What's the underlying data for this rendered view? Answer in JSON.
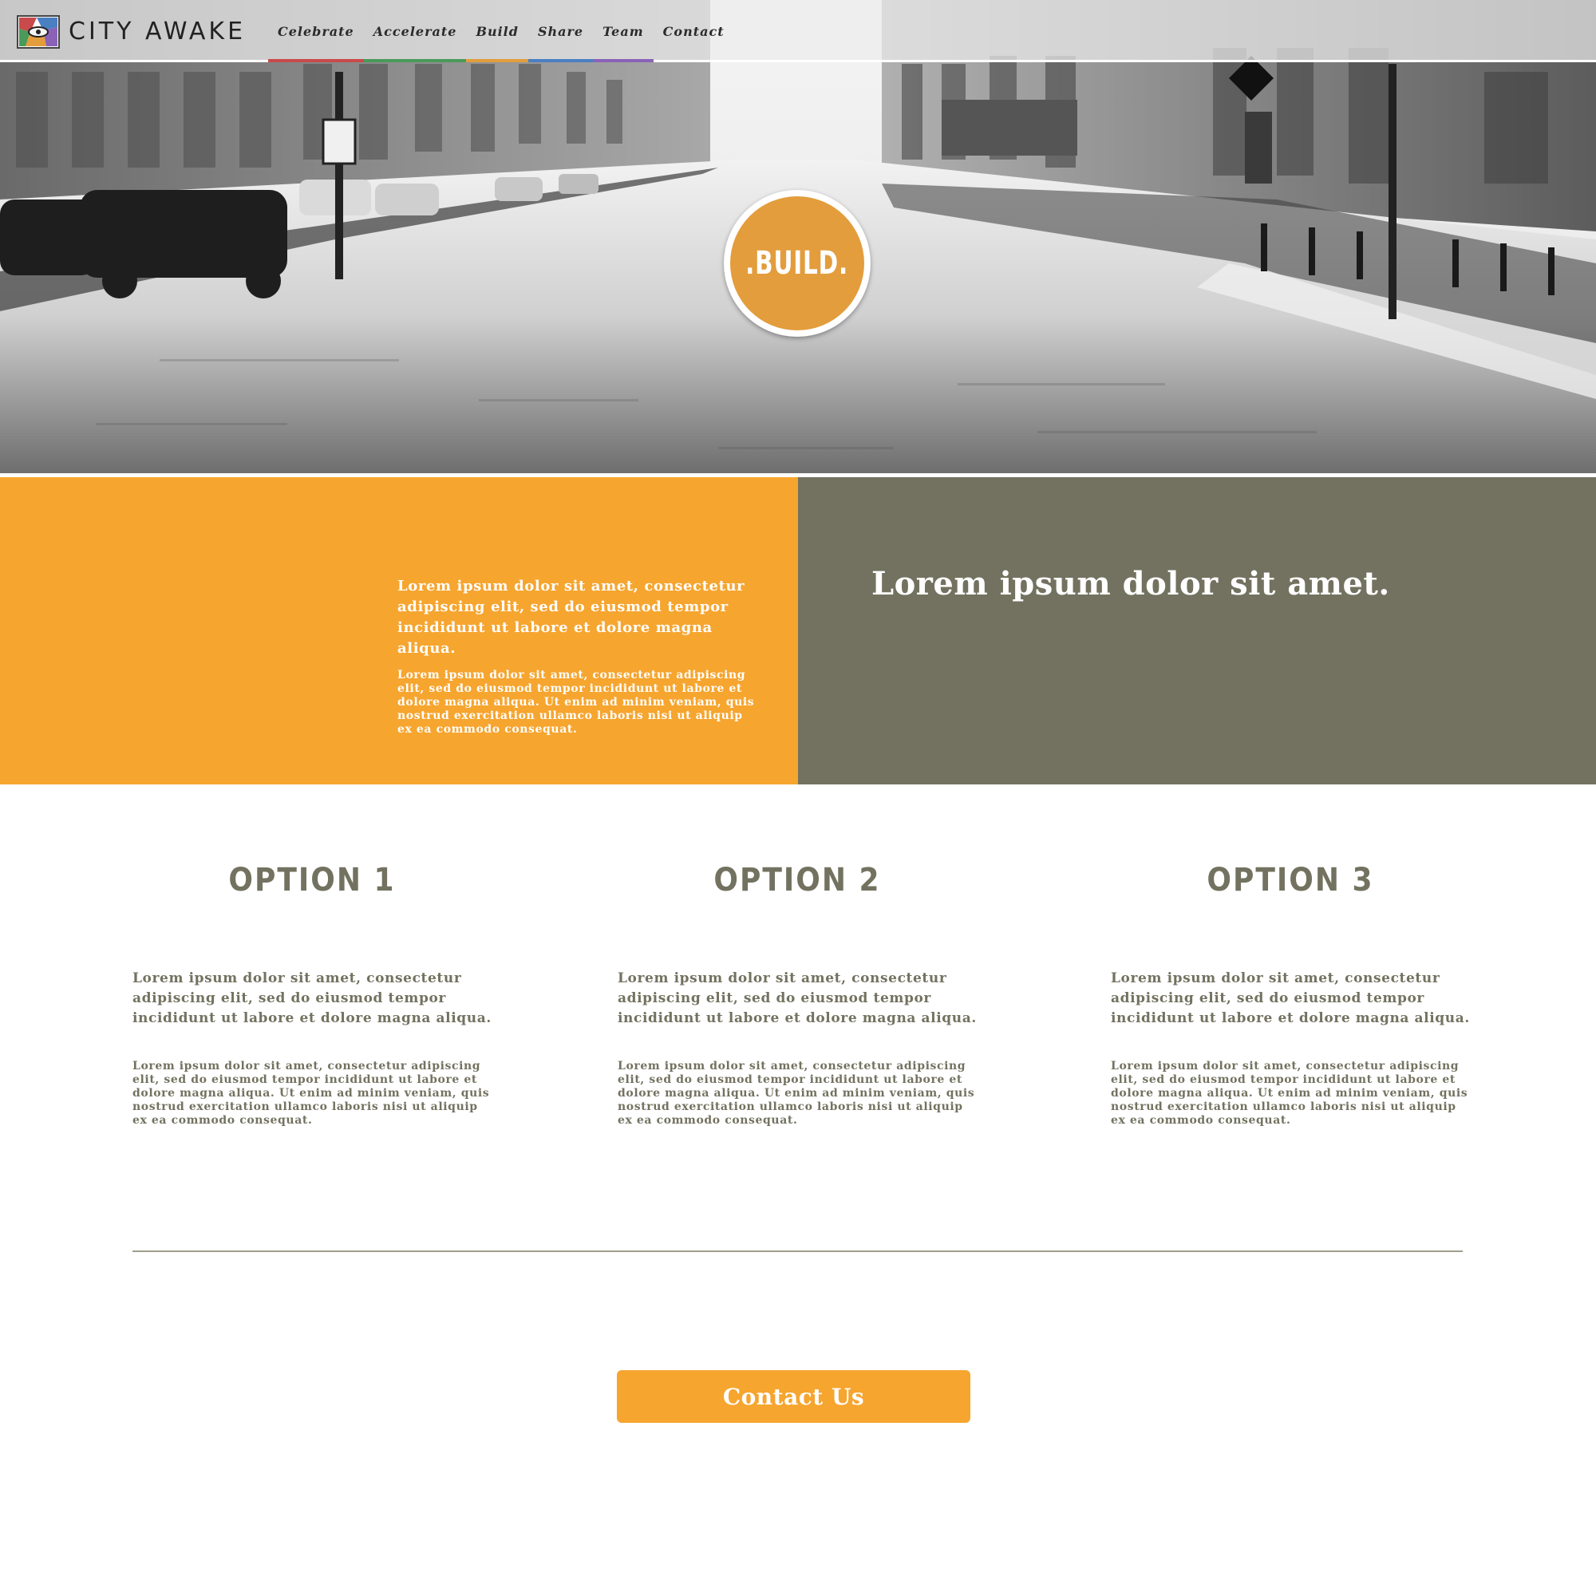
{
  "brand": {
    "name": "CITY AWAKE"
  },
  "nav": {
    "items": [
      {
        "label": "Celebrate",
        "color": "#c94a4a"
      },
      {
        "label": "Accelerate",
        "color": "#4a9a5a"
      },
      {
        "label": "Build",
        "color": "#e39d3c"
      },
      {
        "label": "Share",
        "color": "#4a7fc2"
      },
      {
        "label": "Team",
        "color": "#8a62b8"
      },
      {
        "label": "Contact",
        "color": "#8a62b8"
      }
    ]
  },
  "hero": {
    "badge_label": ".BUILD.",
    "badge_color": "#e39d3c"
  },
  "intro": {
    "lead": "Lorem ipsum dolor sit amet, consectetur adipiscing elit, sed do eiusmod tempor incididunt ut labore et dolore magna aliqua.",
    "body": "Lorem ipsum dolor sit amet, consectetur adipiscing elit, sed do eiusmod tempor incididunt ut labore et dolore magna aliqua. Ut enim ad minim veniam, quis nostrud exercitation ullamco laboris nisi ut aliquip ex ea commodo consequat.",
    "headline": "Lorem ipsum dolor sit amet.",
    "left_color": "#f6a52f",
    "right_color": "#737260"
  },
  "options": [
    {
      "title": "OPTION 1",
      "lead": "Lorem ipsum dolor sit amet, consectetur adipiscing elit, sed do eiusmod tempor incididunt ut labore et dolore magna aliqua.",
      "body": "Lorem ipsum dolor sit amet, consectetur adipiscing elit, sed do eiusmod tempor incididunt ut labore et dolore magna aliqua. Ut enim ad minim veniam, quis nostrud exercitation ullamco laboris nisi ut aliquip ex ea commodo consequat."
    },
    {
      "title": "OPTION 2",
      "lead": "Lorem ipsum dolor sit amet, consectetur adipiscing elit, sed do eiusmod tempor incididunt ut labore et dolore magna aliqua.",
      "body": "Lorem ipsum dolor sit amet, consectetur adipiscing elit, sed do eiusmod tempor incididunt ut labore et dolore magna aliqua. Ut enim ad minim veniam, quis nostrud exercitation ullamco laboris nisi ut aliquip ex ea commodo consequat."
    },
    {
      "title": "OPTION 3",
      "lead": "Lorem ipsum dolor sit amet, consectetur adipiscing elit, sed do eiusmod tempor incididunt ut labore et dolore magna aliqua.",
      "body": "Lorem ipsum dolor sit amet, consectetur adipiscing elit, sed do eiusmod tempor incididunt ut labore et dolore magna aliqua. Ut enim ad minim veniam, quis nostrud exercitation ullamco laboris nisi ut aliquip ex ea commodo consequat."
    }
  ],
  "cta": {
    "label": "Contact Us",
    "color": "#f6a52f"
  }
}
